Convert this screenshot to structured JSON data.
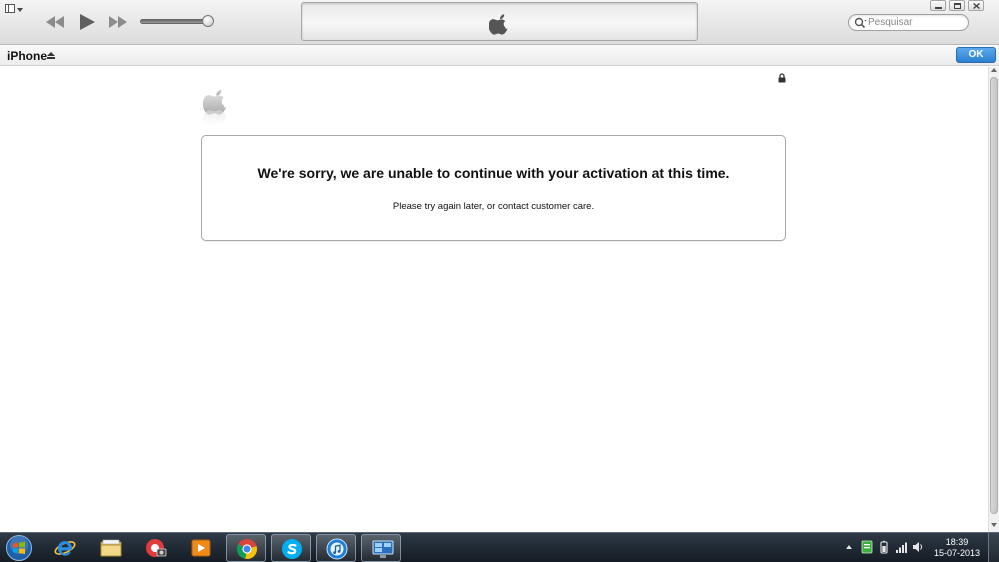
{
  "toolbar": {
    "search_placeholder": "Pesquisar",
    "icons": [
      "app-menu-icon",
      "rewind-icon",
      "play-icon",
      "fast-forward-icon",
      "volume-slider",
      "apple-icon",
      "search-icon",
      "minimize-icon",
      "maximize-icon",
      "close-icon"
    ],
    "volume_level": 0.9
  },
  "device_bar": {
    "device_name": "iPhone",
    "ok_label": "OK"
  },
  "content": {
    "headline": "We're sorry, we are unable to continue with your activation at this time.",
    "subline": "Please try again later, or contact customer care."
  },
  "taskbar": {
    "apps": [
      "internet-explorer",
      "windows-explorer",
      "picasa",
      "media-player",
      "google-chrome",
      "skype",
      "itunes",
      "remote-desktop"
    ],
    "clock_time": "18:39",
    "clock_date": "15-07-2013"
  },
  "colors": {
    "ok_button": "#2c7fd0",
    "taskbar": "#1c2530"
  }
}
